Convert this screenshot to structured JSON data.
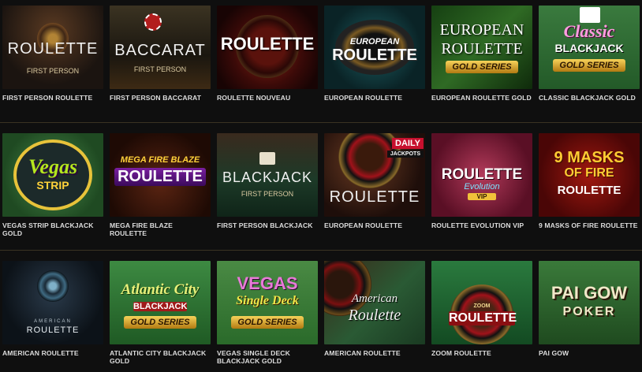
{
  "rows": [
    {
      "tiles": [
        {
          "caption": "FIRST PERSON ROULETTE",
          "art": "ROULETTE",
          "sub": "FIRST PERSON",
          "bg": "#1b1410"
        },
        {
          "caption": "FIRST PERSON BACCARAT",
          "art": "BACCARAT",
          "sub": "FIRST PERSON",
          "bg": "#2b261c"
        },
        {
          "caption": "ROULETTE NOUVEAU",
          "art": "ROULETTE",
          "bg": "#2a0707"
        },
        {
          "caption": "EUROPEAN ROULETTE",
          "art_line1": "EUROPEAN",
          "art_line2": "ROULETTE",
          "bg": "#0d2e33"
        },
        {
          "caption": "EUROPEAN ROULETTE GOLD",
          "art_line1": "EUROPEAN",
          "art_line2": "ROULETTE",
          "art_line3": "GOLD SERIES",
          "bg": "#1f4a1a"
        },
        {
          "caption": "CLASSIC BLACKJACK GOLD",
          "art_line1": "Classic",
          "art_line2": "BLACKJACK",
          "art_line3": "GOLD SERIES",
          "bg": "#2f6e35"
        }
      ]
    },
    {
      "tiles": [
        {
          "caption": "VEGAS STRIP BLACKJACK GOLD",
          "art_line1": "Vegas",
          "art_line2": "STRIP",
          "bg": "#2c5d30"
        },
        {
          "caption": "MEGA FIRE BLAZE ROULETTE",
          "art_line1": "MEGA FIRE BLAZE",
          "art_line2": "ROULETTE",
          "bg": "#3a1a0a"
        },
        {
          "caption": "FIRST PERSON BLACKJACK",
          "art": "BLACKJACK",
          "sub": "FIRST PERSON",
          "bg": "#1e3024"
        },
        {
          "caption": "EUROPEAN ROULETTE",
          "art": "ROULETTE",
          "badge1": "DAILY",
          "badge2": "JACKPOTS",
          "bg": "#2a1410"
        },
        {
          "caption": "ROULETTE EVOLUTION VIP",
          "art_line1": "ROULETTE",
          "art_line2": "Evolution",
          "art_line3": "VIP",
          "bg": "#7b1f3a"
        },
        {
          "caption": "9 MASKS OF FIRE ROULETTE",
          "art_line1": "9 MASKS",
          "art_line2": "OF FIRE",
          "art_line3": "ROULETTE",
          "bg": "#7a0d0d"
        }
      ]
    },
    {
      "tiles": [
        {
          "caption": "AMERICAN ROULETTE",
          "art_line1": "AMERICAN",
          "art_line2": "ROULETTE",
          "bg": "#111820"
        },
        {
          "caption": "ATLANTIC CITY BLACKJACK GOLD",
          "art_line1": "Atlantic City",
          "art_line2": "BLACKJACK",
          "art_line3": "GOLD SERIES",
          "bg": "#2c6a30"
        },
        {
          "caption": "VEGAS SINGLE DECK BLACKJACK GOLD",
          "art_line1": "VEGAS",
          "art_line2": "Single Deck",
          "art_line3": "GOLD SERIES",
          "bg": "#3f7a3a"
        },
        {
          "caption": "AMERICAN ROULETTE",
          "art_line1": "American",
          "art_line2": "Roulette",
          "bg": "#26442c"
        },
        {
          "caption": "ZOOM ROULETTE",
          "art": "ROULETTE",
          "sub": "ZOOM",
          "bg": "#1d5a2e"
        },
        {
          "caption": "PAI GOW",
          "art_line1": "PAI GOW",
          "art_line2": "POKER",
          "bg": "#2d5a2a"
        }
      ]
    }
  ],
  "icons": {
    "wheel": "roulette-wheel-icon",
    "card": "playing-card-icon",
    "chip": "casino-chip-icon"
  },
  "colors": {
    "background": "#0f0f0f",
    "divider": "#3a3322",
    "caption": "#dddddd",
    "gold": "#f0c23a"
  }
}
